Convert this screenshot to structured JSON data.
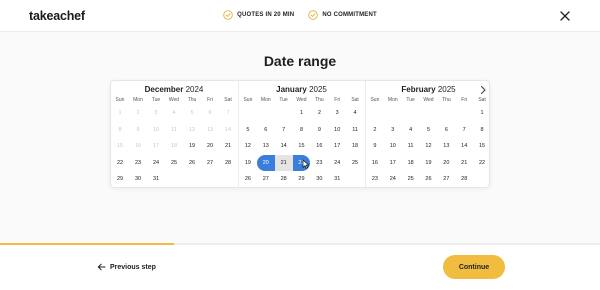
{
  "header": {
    "logo": "takeachef",
    "badges": [
      "QUOTES IN 20 MIN",
      "NO COMMITMENT"
    ]
  },
  "page_title": "Date range",
  "weekdays": [
    "Sun",
    "Mon",
    "Tue",
    "Wed",
    "Thu",
    "Fri",
    "Sat"
  ],
  "months": [
    {
      "name": "December",
      "year": "2024",
      "days": [
        {
          "n": "1",
          "s": "disabled"
        },
        {
          "n": "2",
          "s": "disabled"
        },
        {
          "n": "3",
          "s": "disabled"
        },
        {
          "n": "4",
          "s": "disabled"
        },
        {
          "n": "5",
          "s": "disabled"
        },
        {
          "n": "6",
          "s": "disabled"
        },
        {
          "n": "7",
          "s": "disabled"
        },
        {
          "n": "8",
          "s": "disabled"
        },
        {
          "n": "9",
          "s": "disabled"
        },
        {
          "n": "10",
          "s": "disabled"
        },
        {
          "n": "11",
          "s": "disabled"
        },
        {
          "n": "12",
          "s": "disabled"
        },
        {
          "n": "13",
          "s": "disabled"
        },
        {
          "n": "14",
          "s": "disabled"
        },
        {
          "n": "15",
          "s": "disabled"
        },
        {
          "n": "16",
          "s": "disabled"
        },
        {
          "n": "17",
          "s": "disabled"
        },
        {
          "n": "18",
          "s": "disabled"
        },
        {
          "n": "19",
          "s": ""
        },
        {
          "n": "20",
          "s": ""
        },
        {
          "n": "21",
          "s": ""
        },
        {
          "n": "22",
          "s": ""
        },
        {
          "n": "23",
          "s": ""
        },
        {
          "n": "24",
          "s": ""
        },
        {
          "n": "25",
          "s": ""
        },
        {
          "n": "26",
          "s": ""
        },
        {
          "n": "27",
          "s": ""
        },
        {
          "n": "28",
          "s": ""
        },
        {
          "n": "29",
          "s": ""
        },
        {
          "n": "30",
          "s": ""
        },
        {
          "n": "31",
          "s": ""
        },
        {
          "n": "",
          "s": "empty"
        },
        {
          "n": "",
          "s": "empty"
        },
        {
          "n": "",
          "s": "empty"
        },
        {
          "n": "",
          "s": "empty"
        }
      ]
    },
    {
      "name": "January",
      "year": "2025",
      "days": [
        {
          "n": "",
          "s": "empty"
        },
        {
          "n": "",
          "s": "empty"
        },
        {
          "n": "",
          "s": "empty"
        },
        {
          "n": "1",
          "s": ""
        },
        {
          "n": "2",
          "s": ""
        },
        {
          "n": "3",
          "s": ""
        },
        {
          "n": "4",
          "s": ""
        },
        {
          "n": "5",
          "s": ""
        },
        {
          "n": "6",
          "s": ""
        },
        {
          "n": "7",
          "s": ""
        },
        {
          "n": "8",
          "s": ""
        },
        {
          "n": "9",
          "s": ""
        },
        {
          "n": "10",
          "s": ""
        },
        {
          "n": "11",
          "s": ""
        },
        {
          "n": "12",
          "s": ""
        },
        {
          "n": "13",
          "s": ""
        },
        {
          "n": "14",
          "s": ""
        },
        {
          "n": "15",
          "s": ""
        },
        {
          "n": "16",
          "s": ""
        },
        {
          "n": "17",
          "s": ""
        },
        {
          "n": "18",
          "s": ""
        },
        {
          "n": "19",
          "s": ""
        },
        {
          "n": "20",
          "s": "sel-start"
        },
        {
          "n": "21",
          "s": "in-range"
        },
        {
          "n": "22",
          "s": "sel-end"
        },
        {
          "n": "23",
          "s": ""
        },
        {
          "n": "24",
          "s": ""
        },
        {
          "n": "25",
          "s": ""
        },
        {
          "n": "26",
          "s": ""
        },
        {
          "n": "27",
          "s": ""
        },
        {
          "n": "28",
          "s": ""
        },
        {
          "n": "29",
          "s": ""
        },
        {
          "n": "30",
          "s": ""
        },
        {
          "n": "31",
          "s": ""
        },
        {
          "n": "",
          "s": "empty"
        }
      ]
    },
    {
      "name": "February",
      "year": "2025",
      "days": [
        {
          "n": "",
          "s": "empty"
        },
        {
          "n": "",
          "s": "empty"
        },
        {
          "n": "",
          "s": "empty"
        },
        {
          "n": "",
          "s": "empty"
        },
        {
          "n": "",
          "s": "empty"
        },
        {
          "n": "",
          "s": "empty"
        },
        {
          "n": "1",
          "s": ""
        },
        {
          "n": "2",
          "s": ""
        },
        {
          "n": "3",
          "s": ""
        },
        {
          "n": "4",
          "s": ""
        },
        {
          "n": "5",
          "s": ""
        },
        {
          "n": "6",
          "s": ""
        },
        {
          "n": "7",
          "s": ""
        },
        {
          "n": "8",
          "s": ""
        },
        {
          "n": "9",
          "s": ""
        },
        {
          "n": "10",
          "s": ""
        },
        {
          "n": "11",
          "s": ""
        },
        {
          "n": "12",
          "s": ""
        },
        {
          "n": "13",
          "s": ""
        },
        {
          "n": "14",
          "s": ""
        },
        {
          "n": "15",
          "s": ""
        },
        {
          "n": "16",
          "s": ""
        },
        {
          "n": "17",
          "s": ""
        },
        {
          "n": "18",
          "s": ""
        },
        {
          "n": "19",
          "s": ""
        },
        {
          "n": "20",
          "s": ""
        },
        {
          "n": "21",
          "s": ""
        },
        {
          "n": "22",
          "s": ""
        },
        {
          "n": "23",
          "s": ""
        },
        {
          "n": "24",
          "s": ""
        },
        {
          "n": "25",
          "s": ""
        },
        {
          "n": "26",
          "s": ""
        },
        {
          "n": "27",
          "s": ""
        },
        {
          "n": "28",
          "s": ""
        },
        {
          "n": "",
          "s": "empty"
        }
      ]
    }
  ],
  "progress_fraction": 0.29,
  "footer": {
    "prev_label": "Previous step",
    "continue_label": "Continue"
  },
  "colors": {
    "accent": "#f0bd41",
    "selected": "#3b7ddd",
    "range": "#e4e4e4"
  },
  "icons": {
    "badge": "check-circle-icon",
    "close": "close-icon",
    "next_month": "chevron-right-icon",
    "previous": "arrow-left-icon"
  }
}
